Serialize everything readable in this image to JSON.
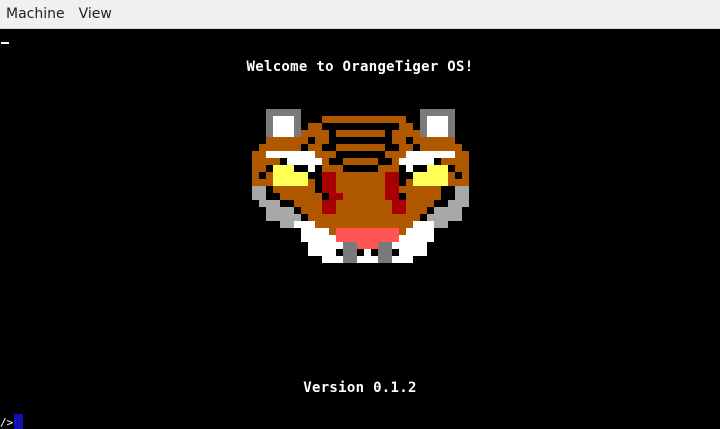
{
  "menubar": {
    "items": [
      "Machine",
      "View"
    ]
  },
  "screen": {
    "welcome": "Welcome to OrangeTiger OS!",
    "version": "Version 0.1.2",
    "prompt": "/>"
  },
  "logo": {
    "palette": {
      "O": "#b05800",
      "W": "#ffffff",
      "G": "#7a7a7a",
      "L": "#a8a8a8",
      "Y": "#ffff55",
      "R": "#a80000",
      "P": "#ff5555",
      "K": "#000000"
    },
    "pixels": [
      "..GGGGG.................GGGGG...",
      "..GWWWG...OOOOOOOOOOOO..GWWWG...",
      "..GWWWG.OOKKKKKKKKKKKOO.GWWWG...",
      "..GWWWGOOOOKOOOOOOOKOOOOGWWWG...",
      "..OOOOOOKOOKKKKKKKKKOOKOOOOOO...",
      ".OOOOOOKOOKKOOOOOOOKKOOKOOOOOO..",
      "OOWWWWWWWOOOKKKKKKKOOOWWWWWWWOO.",
      "OOOOKWWWWWOKKOOOOOKKOWWWWWKOOOO.",
      "OOKYYYKKWKOOOKKKKKOOOKWKKYYYKOO.",
      "OKOYYYYYKKRROOOOOOORRKKYYYYYOKO.",
      "OOOYYYYYOKRROOOOOOORRKOYYYYYOOO.",
      "LLKOOOOOOKRROOOOOOORROOOOOOKKLL.",
      "LLKKOOOOOOKRROOOOOORRKOOOOOKKLL.",
      ".LLLKKOOOORROOOOOOOORROOOOKKLLL.",
      "..LLLLKOOORROOOOOOOORROOOKLLLL..",
      "..LLLLLKOOOOOOOOOOOOOOOOKLLLLL..",
      "....LLWWWOOOOOOOOOOOOOOWWWLL....",
      ".......WWWWOPPPPPPPPPOWWWW......",
      ".......WWWWWPPPPPPPPPWWWWW......",
      "........WWWWWGGPPPGGWWWWW.......",
      "........WWWWKGGKWKGGKWWWW.......",
      "..........WWWGGWWWGGWWW........."
    ]
  }
}
